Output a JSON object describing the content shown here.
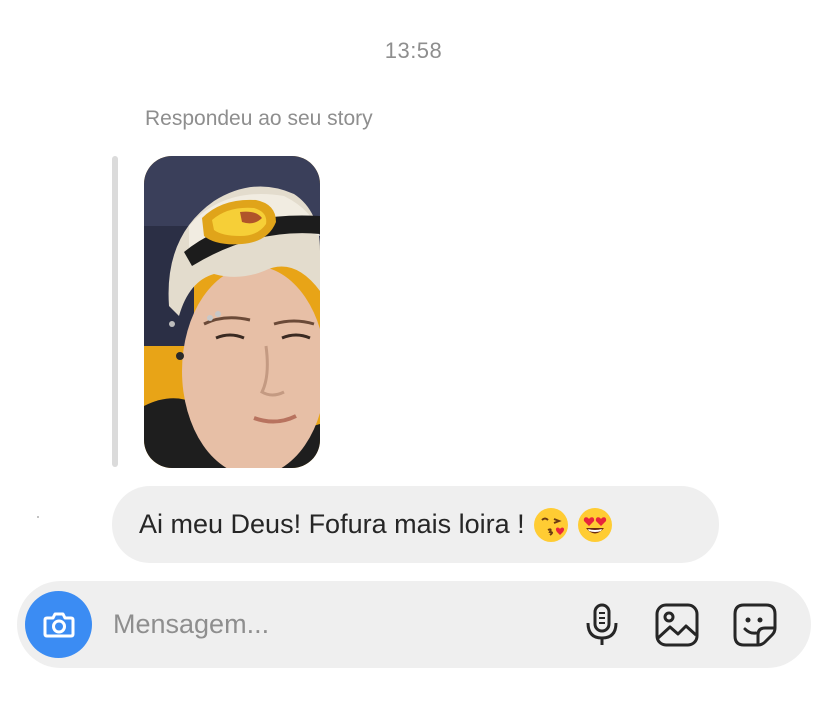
{
  "thread": {
    "timestamp": "13:58",
    "reply_note": "Respondeu ao seu story"
  },
  "message": {
    "text": "Ai meu Deus! Fofura mais loira !",
    "emojis": [
      "face-blowing-kiss",
      "smiling-face-with-heart-eyes"
    ]
  },
  "composer": {
    "placeholder": "Mensagem...",
    "camera_icon": "camera-icon",
    "mic_icon": "microphone-icon",
    "gallery_icon": "image-gallery-icon",
    "sticker_icon": "sticker-icon"
  },
  "colors": {
    "accent": "#3b8cf3",
    "bubble": "#efefef",
    "muted_text": "#8e8e8e"
  }
}
